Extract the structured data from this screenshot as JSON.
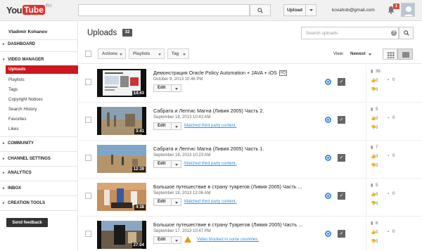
{
  "header": {
    "logo_you": "You",
    "logo_tube": "Tube",
    "logo_region": "RU",
    "upload_label": "Upload",
    "email": "koxahob@gmail.com",
    "notifications": "1"
  },
  "sidebar": {
    "user": "Vladimir Kohanov",
    "dashboard": "DASHBOARD",
    "video_manager": "VIDEO MANAGER",
    "items": [
      "Uploads",
      "Playlists",
      "Tags",
      "Copyright Notices",
      "Search History",
      "Favorites",
      "Likes"
    ],
    "community": "COMMUNITY",
    "channel_settings": "CHANNEL SETTINGS",
    "analytics": "ANALYTICS",
    "inbox": "INBOX",
    "creation_tools": "CREATION TOOLS",
    "feedback": "Send feedback"
  },
  "main": {
    "title": "Uploads",
    "count": "32",
    "search_placeholder": "Search uploads",
    "actions": "Actions",
    "playlists": "Playlists",
    "tag": "Tag",
    "view_label": "View:",
    "sort": "Newest"
  },
  "videos": [
    {
      "title": "Демонстрация Oracle Policy Automation + JAVA + iOS",
      "hq": "HQ",
      "date": "October 9, 2013 10:46 PM",
      "duration": "14:43",
      "edit": "Edit",
      "claim": "",
      "views": "36",
      "likes": "0",
      "dislikes": "0",
      "comments": "0"
    },
    {
      "title": "Сабрата и Лептис Магна (Ливия 2005) Часть 2.",
      "date": "September 18, 2013 10:43 AM",
      "duration": "3:41",
      "edit": "Edit",
      "claim": "Matched third party content.",
      "views": "5",
      "likes": "0",
      "dislikes": "0",
      "comments": "0"
    },
    {
      "title": "Сабрата и Лептис Магна (Ливия 2005) Часть 1.",
      "date": "September 18, 2013 10:23 AM",
      "duration": "12:39",
      "edit": "Edit",
      "claim": "Matched third party content.",
      "views": "7",
      "likes": "0",
      "dislikes": "0",
      "comments": "0"
    },
    {
      "title": "Большое путешествие в страну туарегов (Ливия 2005) Часть ...",
      "date": "September 18, 2013 12:06 AM",
      "duration": "4:38",
      "edit": "Edit",
      "claim": "Matched third party content.",
      "views": "5",
      "likes": "0",
      "dislikes": "0",
      "comments": "0"
    },
    {
      "title": "Большое путешествие в страну Туарегов (Ливия 2005) Часть ...",
      "date": "September 17, 2013 10:47 PM",
      "duration": "27:04",
      "edit": "Edit",
      "claim": "Video blocked in some countries.",
      "views": "6",
      "likes": "0",
      "dislikes": "0",
      "comments": "0"
    }
  ],
  "colors": {
    "brand_red": "#cc181e",
    "link": "#2793e6",
    "warning": "#e69a12"
  }
}
